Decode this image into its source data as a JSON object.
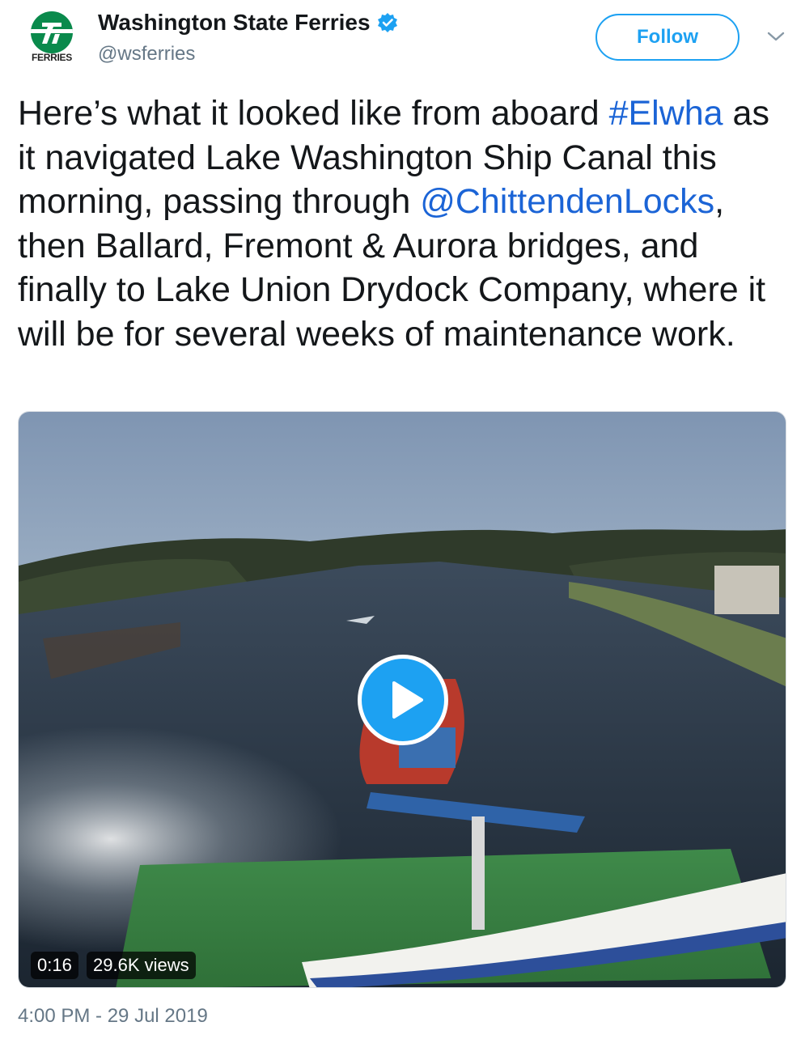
{
  "account": {
    "display_name": "Washington State Ferries",
    "handle": "@wsferries",
    "logo_text": "FERRIES",
    "verified": true
  },
  "actions": {
    "follow_label": "Follow",
    "menu_icon": "chevron-down-icon"
  },
  "tweet": {
    "part1": "Here’s what it looked like from aboard ",
    "hashtag": "#Elwha",
    "part2": " as it navigated Lake Washington Ship Canal this morning, passing through ",
    "mention": "@ChittendenLocks",
    "part3": ", then Ballard, Fremont & Aurora bridges, and finally to Lake Union Drydock Company, where it will be for several weeks of maintenance work."
  },
  "video": {
    "duration": "0:16",
    "views": "29.6K views",
    "play_icon": "play-icon"
  },
  "timestamp": "4:00 PM - 29 Jul 2019",
  "colors": {
    "accent": "#1da1f2",
    "link": "#1b64d6",
    "brand_green": "#0a8a4c",
    "muted": "#657786"
  }
}
